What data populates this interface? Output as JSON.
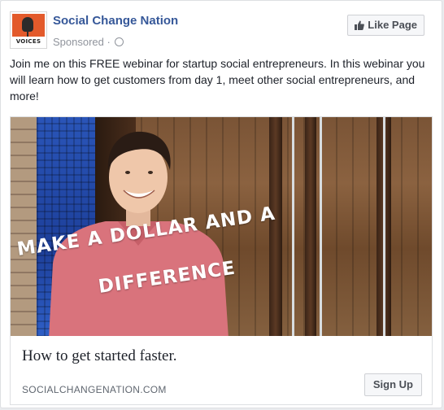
{
  "post": {
    "page_name": "Social Change Nation",
    "sponsored_label": "Sponsored",
    "separator": "·",
    "privacy_icon": "globe-icon",
    "like_button_label": "Like Page",
    "like_icon": "thumbs-up-icon",
    "avatar_text": "VOICES",
    "body_text": "Join me on this FREE webinar for startup social entrepreneurs. In this webinar you will learn how to get customers from day 1, meet other social entrepreneurs, and more!"
  },
  "ad_image": {
    "overlay_line1": "MAKE A DOLLAR AND A",
    "overlay_line2": "DIFFERENCE"
  },
  "link_preview": {
    "headline": "How to get started faster.",
    "domain": "SOCIALCHANGENATION.COM",
    "cta_label": "Sign Up"
  },
  "colors": {
    "page_name": "#365899",
    "meta_text": "#90949c",
    "body_text": "#1d2129",
    "button_bg": "#f6f7f9",
    "avatar_accent": "#e35a2b"
  }
}
